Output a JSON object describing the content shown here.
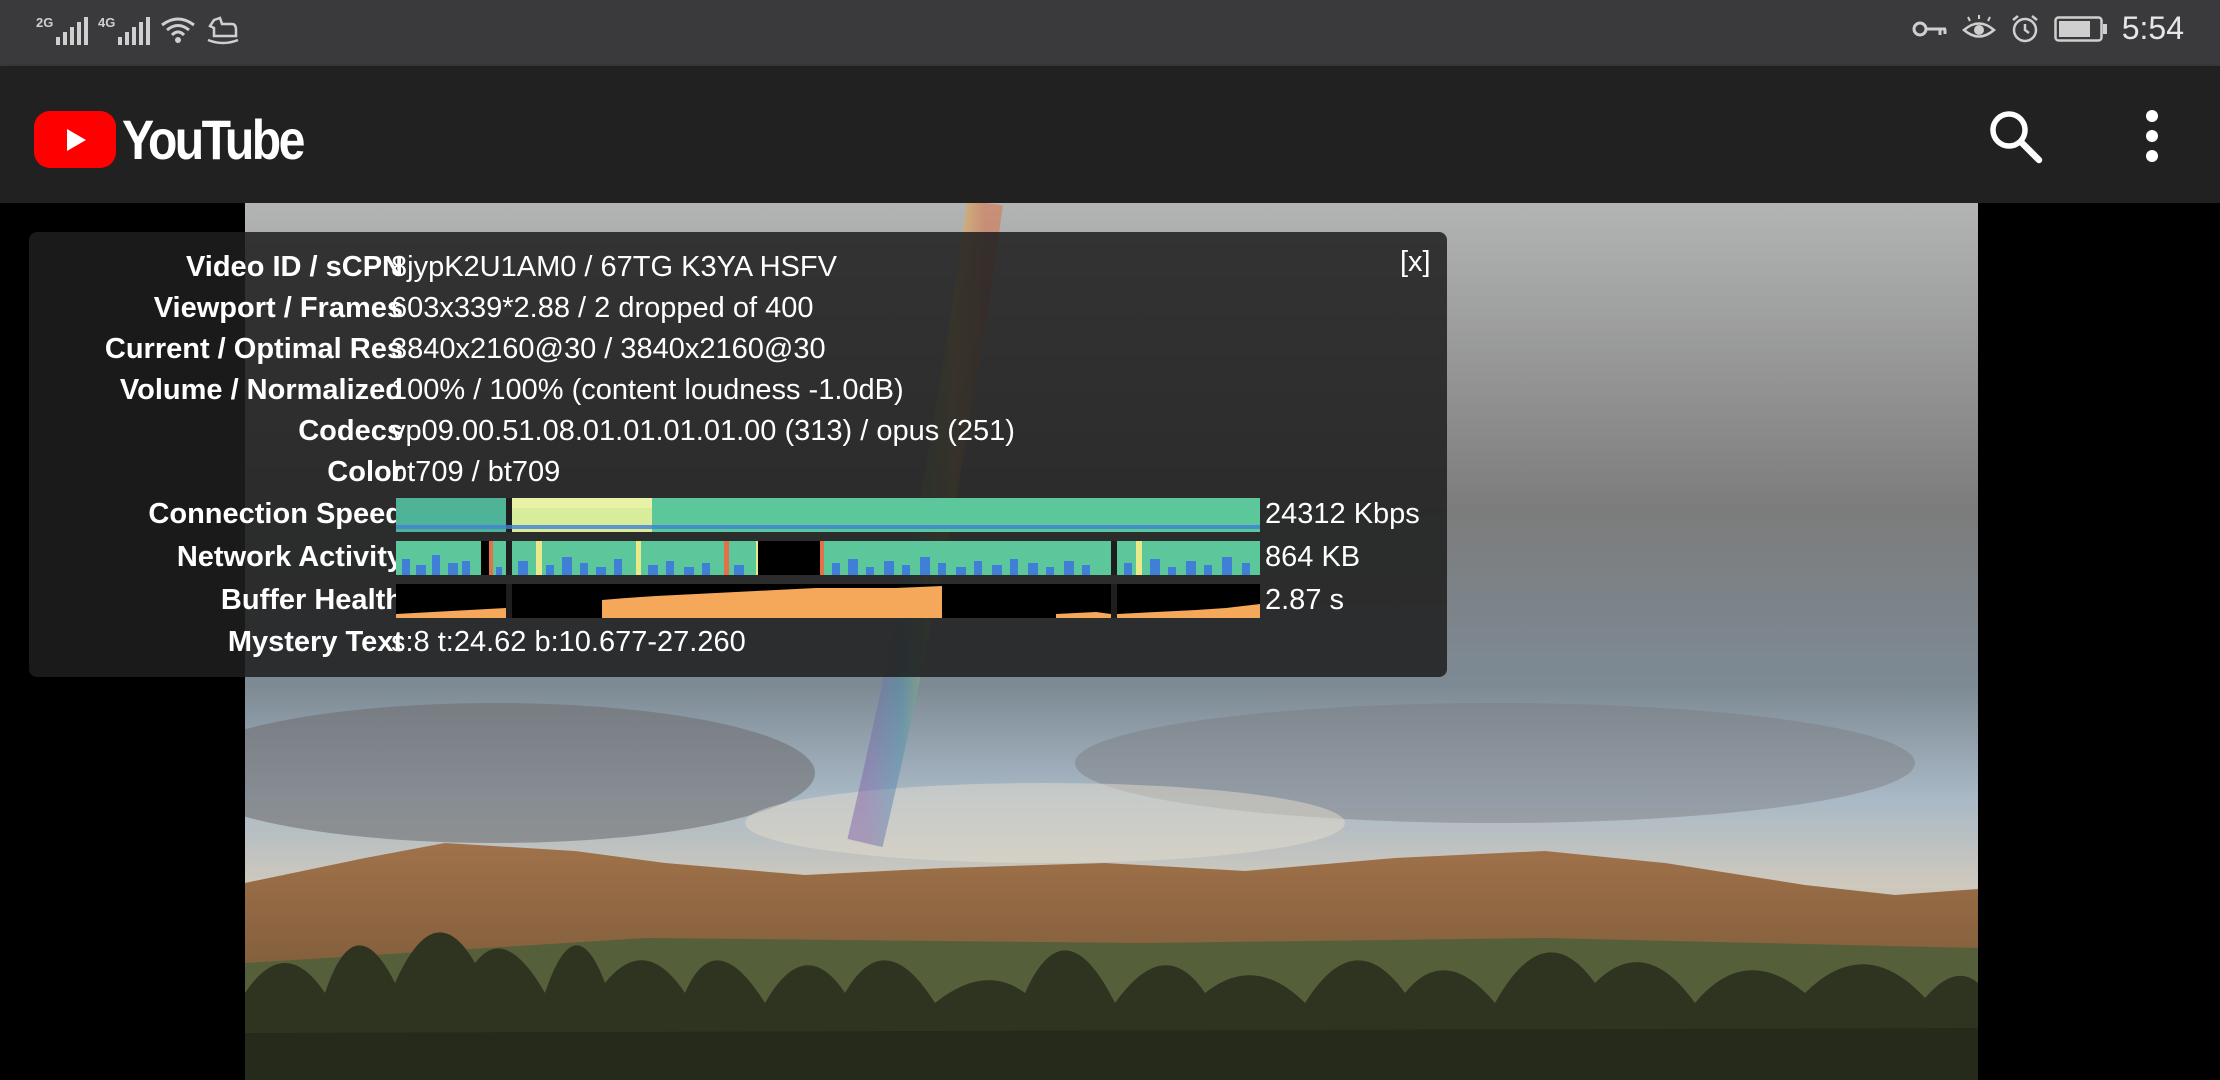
{
  "status_bar": {
    "sim1": {
      "label": "2G"
    },
    "sim2": {
      "label": "4G"
    },
    "time": "5:54",
    "icons": [
      "signal-icon",
      "wifi-icon",
      "rocking-horse-icon",
      "key-icon",
      "eye-icon",
      "alarm-icon",
      "battery-icon"
    ]
  },
  "app_bar": {
    "app_name": "YouTube",
    "brand_color": "#ff0000",
    "actions": [
      "search-icon",
      "more-vert-icon"
    ]
  },
  "stats_for_nerds": {
    "close_label": "[x]",
    "rows": [
      {
        "label": "Video ID / sCPN",
        "value": "8jypK2U1AM0 / 67TG K3YA HSFV"
      },
      {
        "label": "Viewport / Frames",
        "value": "603x339*2.88 / 2 dropped of 400"
      },
      {
        "label": "Current / Optimal Res",
        "value": "3840x2160@30 / 3840x2160@30"
      },
      {
        "label": "Volume / Normalized",
        "value": "100% / 100% (content loudness -1.0dB)"
      },
      {
        "label": "Codecs",
        "value": "vp09.00.51.08.01.01.01.01.00 (313) / opus (251)"
      },
      {
        "label": "Color",
        "value": "bt709 / bt709"
      }
    ],
    "graphs": [
      {
        "label": "Connection Speed",
        "value": "24312 Kbps",
        "color": "#5cc79a"
      },
      {
        "label": "Network Activity",
        "value": "864 KB",
        "color": "#4a8fdb"
      },
      {
        "label": "Buffer Health",
        "value": "2.87 s",
        "color": "#f5a85a"
      }
    ],
    "mystery": {
      "label": "Mystery Text",
      "value": "s:8 t:24.62 b:10.677-27.260"
    }
  },
  "colors": {
    "status_bar_bg": "#3a3a3c",
    "app_bar_bg": "#212121",
    "overlay_bg": "rgba(30,30,30,0.86)",
    "graph_green": "#5cc79a",
    "graph_blue": "#3f7fd6",
    "graph_orange": "#f5a85a",
    "graph_yellow": "#e9e98a"
  }
}
